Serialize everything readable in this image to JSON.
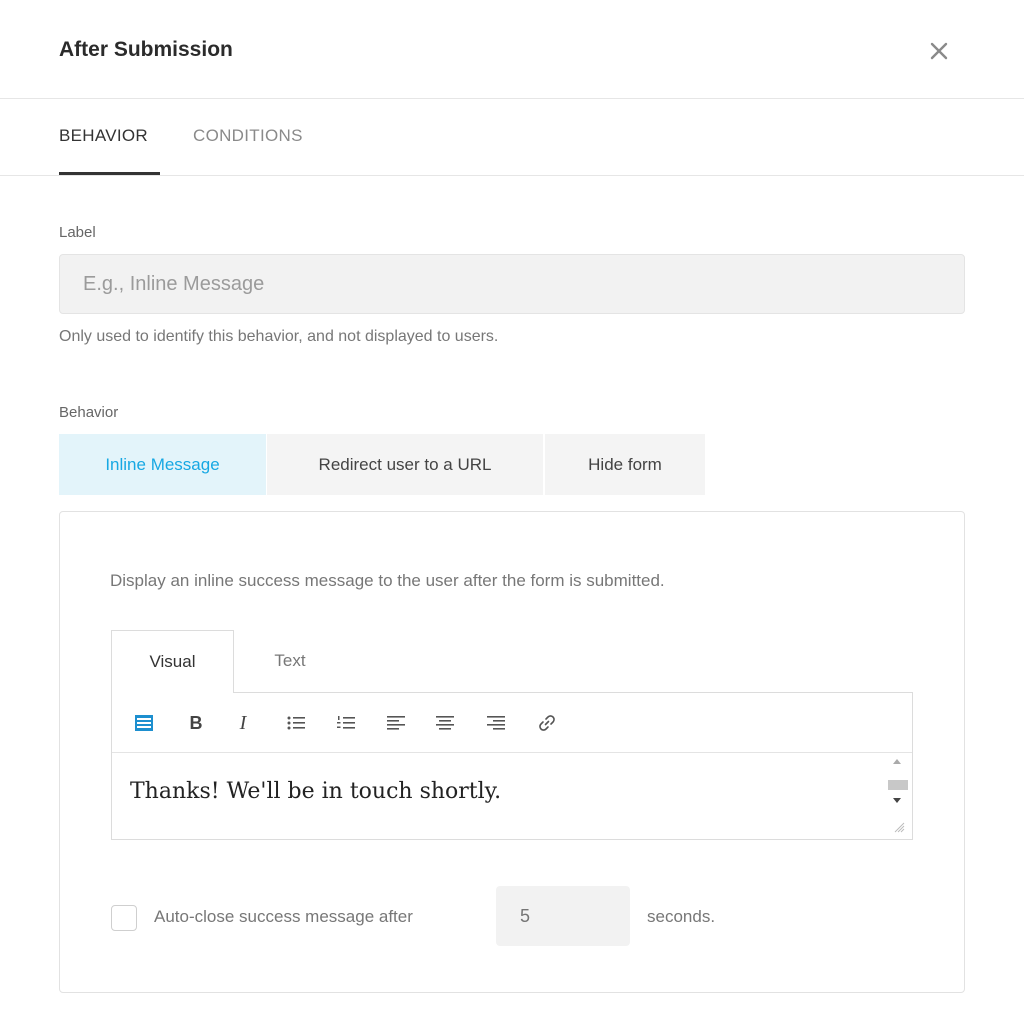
{
  "dialog": {
    "title": "After Submission",
    "close_icon": "close-icon"
  },
  "tabs": [
    {
      "label": "BEHAVIOR",
      "active": true
    },
    {
      "label": "CONDITIONS",
      "active": false
    }
  ],
  "label_field": {
    "label": "Label",
    "placeholder": "E.g., Inline Message",
    "value": "",
    "help": "Only used to identify this behavior, and not displayed to users."
  },
  "behavior": {
    "label": "Behavior",
    "options": [
      {
        "label": "Inline Message",
        "selected": true
      },
      {
        "label": "Redirect user to a URL",
        "selected": false
      },
      {
        "label": "Hide form",
        "selected": false
      }
    ],
    "accent_color": "#17a8e3"
  },
  "inline_message": {
    "description": "Display an inline success message to the user after the form is submitted.",
    "editor_tabs": [
      {
        "label": "Visual",
        "active": true
      },
      {
        "label": "Text",
        "active": false
      }
    ],
    "toolbar": [
      {
        "icon": "toolbar-toggle-icon"
      },
      {
        "icon": "bold-icon",
        "glyph": "B"
      },
      {
        "icon": "italic-icon",
        "glyph": "I"
      },
      {
        "icon": "bulleted-list-icon"
      },
      {
        "icon": "numbered-list-icon"
      },
      {
        "icon": "align-left-icon"
      },
      {
        "icon": "align-center-icon"
      },
      {
        "icon": "align-right-icon"
      },
      {
        "icon": "link-icon"
      }
    ],
    "content": "Thanks! We'll be in touch shortly.",
    "auto_close": {
      "checked": false,
      "label": "Auto-close success message after",
      "placeholder": "5",
      "value": "",
      "unit": "seconds."
    }
  }
}
